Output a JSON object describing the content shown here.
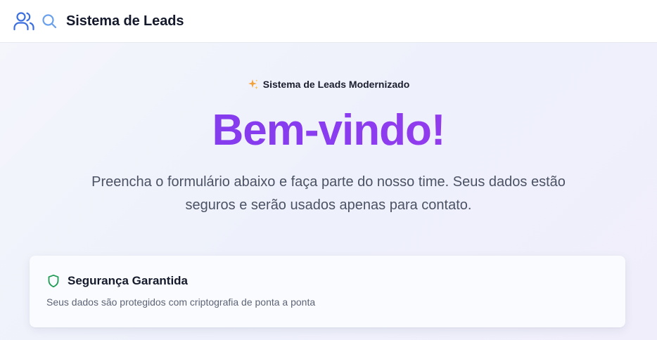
{
  "header": {
    "title": "Sistema de Leads",
    "icons": [
      "users-icon",
      "search-icon"
    ]
  },
  "hero": {
    "badge": "Sistema de Leads Modernizado",
    "badge_icon": "sparkle-icon",
    "headline": "Bem-vindo!",
    "subtitle": "Preencha o formulário abaixo e faça parte do nosso time. Seus dados estão seguros e serão usados apenas para contato."
  },
  "security_card": {
    "icon": "shield-icon",
    "title": "Segurança Garantida",
    "description": "Seus dados são protegidos com criptografia de ponta a ponta"
  },
  "colors": {
    "brand_blue": "#3b6fe0",
    "headline_purple": "#8b3cf0",
    "shield_green": "#1f9d55",
    "sparkle_orange": "#f2a23a"
  }
}
